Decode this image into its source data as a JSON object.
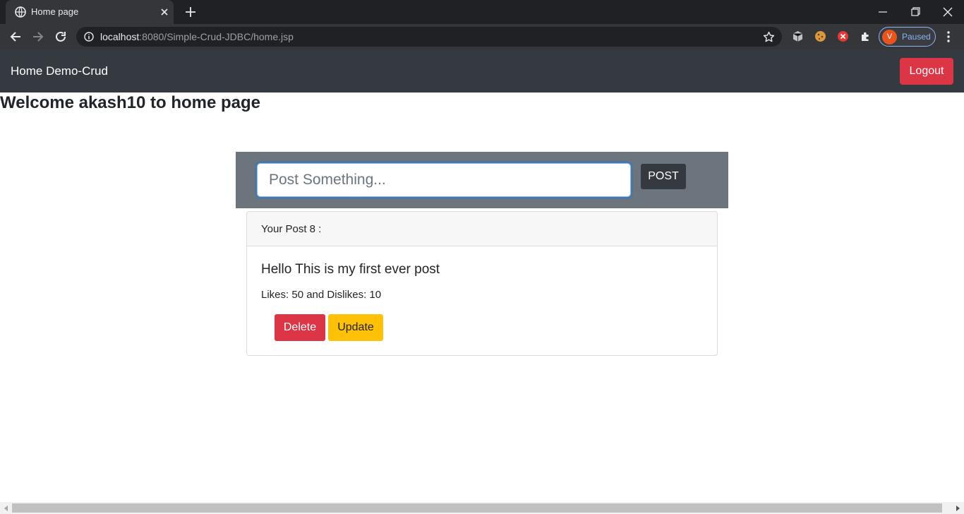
{
  "browser": {
    "tab_title": "Home page",
    "url_host": "localhost",
    "url_rest": ":8080/Simple-Crud-JDBC/home.jsp",
    "profile_initial": "V",
    "profile_status": "Paused"
  },
  "navbar": {
    "brand": "Home Demo-Crud",
    "logout_label": "Logout"
  },
  "page": {
    "welcome": "Welcome akash10 to home page"
  },
  "post_form": {
    "placeholder": "Post Something...",
    "value": "",
    "submit_label": "POST"
  },
  "posts": [
    {
      "header": "Your Post 8 :",
      "title": "Hello This is my first ever post",
      "stats": "Likes: 50 and Dislikes: 10",
      "delete_label": "Delete",
      "update_label": "Update"
    }
  ],
  "colors": {
    "navbar": "#343a40",
    "danger": "#dc3545",
    "warning": "#ffc107",
    "form_bg": "#6c757d"
  }
}
